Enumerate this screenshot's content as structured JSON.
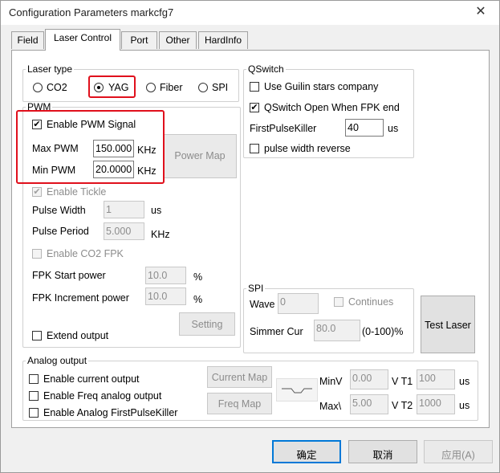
{
  "window": {
    "title": "Configuration Parameters markcfg7",
    "close_glyph": "✕"
  },
  "tabs": [
    "Field",
    "Laser Control",
    "Port",
    "Other",
    "HardInfo"
  ],
  "laser_type": {
    "legend": "Laser type",
    "options": [
      "CO2",
      "YAG",
      "Fiber",
      "SPI"
    ],
    "selected": "YAG"
  },
  "pwm": {
    "legend": "PWM",
    "enable_pwm_label": "Enable PWM Signal",
    "max_pwm_label": "Max PWM",
    "max_pwm_value": "150.000",
    "max_pwm_unit": "KHz",
    "min_pwm_label": "Min PWM",
    "min_pwm_value": "20.0000",
    "min_pwm_unit": "KHz",
    "power_map_label": "Power Map",
    "enable_tickle_label": "Enable Tickle",
    "pulse_width_label": "Pulse Width",
    "pulse_width_value": "1",
    "pulse_width_unit": "us",
    "pulse_period_label": "Pulse Period",
    "pulse_period_value": "5.000",
    "pulse_period_unit": "KHz",
    "enable_co2_fpk_label": "Enable CO2 FPK",
    "fpk_start_label": "FPK Start power",
    "fpk_start_value": "10.0",
    "fpk_start_unit": "%",
    "fpk_inc_label": "FPK Increment power",
    "fpk_inc_value": "10.0",
    "fpk_inc_unit": "%",
    "setting_label": "Setting",
    "extend_output_label": "Extend output"
  },
  "qswitch": {
    "legend": "QSwitch",
    "guilin_label": "Use Guilin stars company",
    "open_fpk_label": "QSwitch Open When FPK end",
    "first_pulse_label": "FirstPulseKiller",
    "first_pulse_value": "40",
    "first_pulse_unit": "us",
    "pulse_width_reverse_label": "pulse width reverse"
  },
  "spi": {
    "legend": "SPI",
    "wave_label": "Wave",
    "wave_value": "0",
    "continues_label": "Continues",
    "simmer_label": "Simmer Cur",
    "simmer_value": "80.0",
    "simmer_range": "(0-100)%"
  },
  "test_laser_label": "Test Laser",
  "analog": {
    "legend": "Analog output",
    "current_label": "Enable current output",
    "freq_label": "Enable Freq analog output",
    "fpk_label": "Enable Analog FirstPulseKiller",
    "current_map_label": "Current Map",
    "freq_map_label": "Freq Map",
    "minv_label": "MinV",
    "minv_value": "0.00",
    "t1_label": "V T1",
    "t1_value": "100",
    "t1_unit": "us",
    "maxv_label": "Max\\",
    "maxv_value": "5.00",
    "t2_label": "V T2",
    "t2_value": "1000",
    "t2_unit": "us"
  },
  "footer": {
    "ok": "确定",
    "cancel": "取消",
    "apply": "应用(A)"
  },
  "colors": {
    "highlight_box": "#e0101c",
    "window_bg": "#f0f0f0"
  }
}
